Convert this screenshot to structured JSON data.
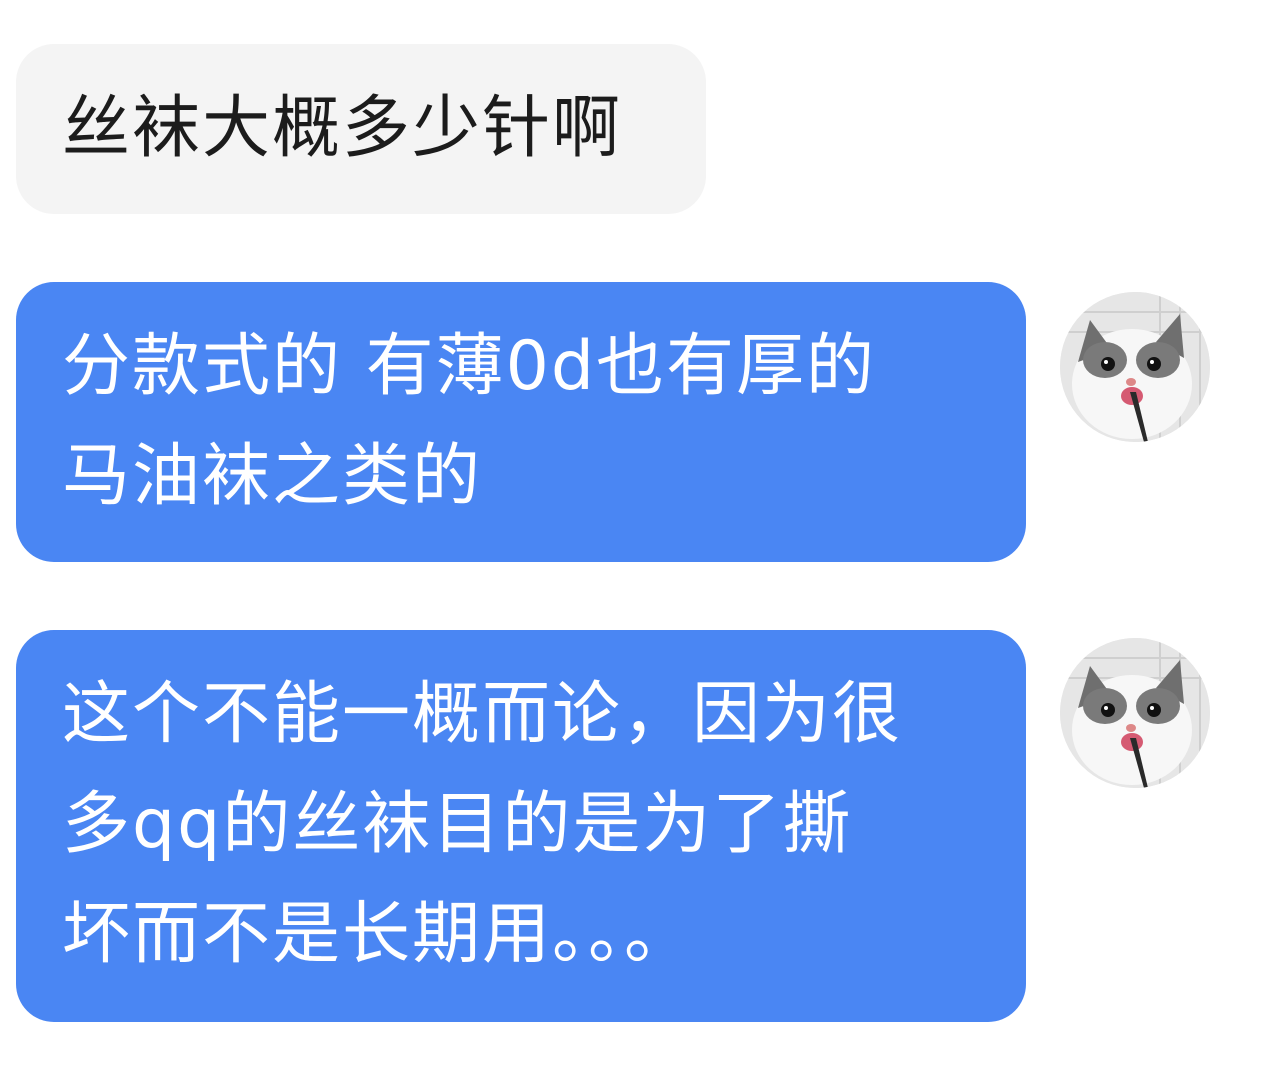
{
  "messages": [
    {
      "direction": "incoming",
      "text": "丝袜大概多少针啊"
    },
    {
      "direction": "outgoing",
      "text": "分款式的 有薄0d也有厚的\n马油袜之类的"
    },
    {
      "direction": "outgoing",
      "text": "这个不能一概而论，因为很\n多qq的丝袜目的是为了撕\n坏而不是长期用。。。"
    }
  ],
  "avatar": {
    "icon": "cat-avatar-icon"
  },
  "colors": {
    "incoming_bubble": "#f4f4f4",
    "outgoing_bubble": "#4a86f3",
    "outgoing_text": "#ffffff",
    "incoming_text": "#1c1c1c"
  }
}
